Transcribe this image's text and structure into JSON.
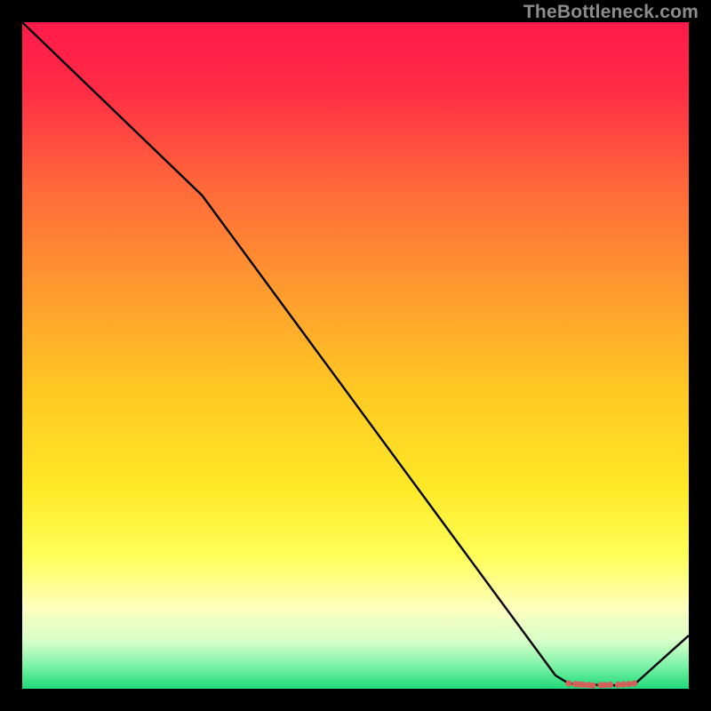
{
  "attribution": "TheBottleneck.com",
  "chart_data": {
    "type": "line",
    "title": "",
    "xlabel": "",
    "ylabel": "",
    "xlim": [
      0,
      100
    ],
    "ylim": [
      0,
      100
    ],
    "x": [
      0,
      27,
      80,
      82,
      83,
      84,
      85,
      86,
      87,
      88,
      89,
      90,
      91,
      92,
      100
    ],
    "values": [
      100,
      74,
      2,
      0.8,
      0.7,
      0.6,
      0.5,
      0.6,
      0.5,
      0.6,
      0.5,
      0.6,
      0.7,
      0.8,
      8
    ],
    "marker_points": [
      {
        "x": 82,
        "y": 0.8
      },
      {
        "x": 83,
        "y": 0.7
      },
      {
        "x": 83.6,
        "y": 0.65
      },
      {
        "x": 84.2,
        "y": 0.6
      },
      {
        "x": 85,
        "y": 0.55
      },
      {
        "x": 85.6,
        "y": 0.5
      },
      {
        "x": 86.8,
        "y": 0.55
      },
      {
        "x": 87.4,
        "y": 0.55
      },
      {
        "x": 88.2,
        "y": 0.6
      },
      {
        "x": 89.4,
        "y": 0.6
      },
      {
        "x": 90.2,
        "y": 0.65
      },
      {
        "x": 91,
        "y": 0.7
      },
      {
        "x": 91.8,
        "y": 0.8
      }
    ],
    "gradient_stops": [
      {
        "offset": 0.0,
        "color": "#ff1a4a"
      },
      {
        "offset": 0.1,
        "color": "#ff2b45"
      },
      {
        "offset": 0.25,
        "color": "#ff6a3a"
      },
      {
        "offset": 0.4,
        "color": "#ff9a2f"
      },
      {
        "offset": 0.55,
        "color": "#ffc823"
      },
      {
        "offset": 0.7,
        "color": "#ffe927"
      },
      {
        "offset": 0.8,
        "color": "#ffff59"
      },
      {
        "offset": 0.88,
        "color": "#ffffc0"
      },
      {
        "offset": 0.93,
        "color": "#d4ffc8"
      },
      {
        "offset": 0.965,
        "color": "#7ef3a8"
      },
      {
        "offset": 1.0,
        "color": "#1fd878"
      }
    ],
    "line_color": "#000000",
    "marker_color": "#d4605a"
  }
}
